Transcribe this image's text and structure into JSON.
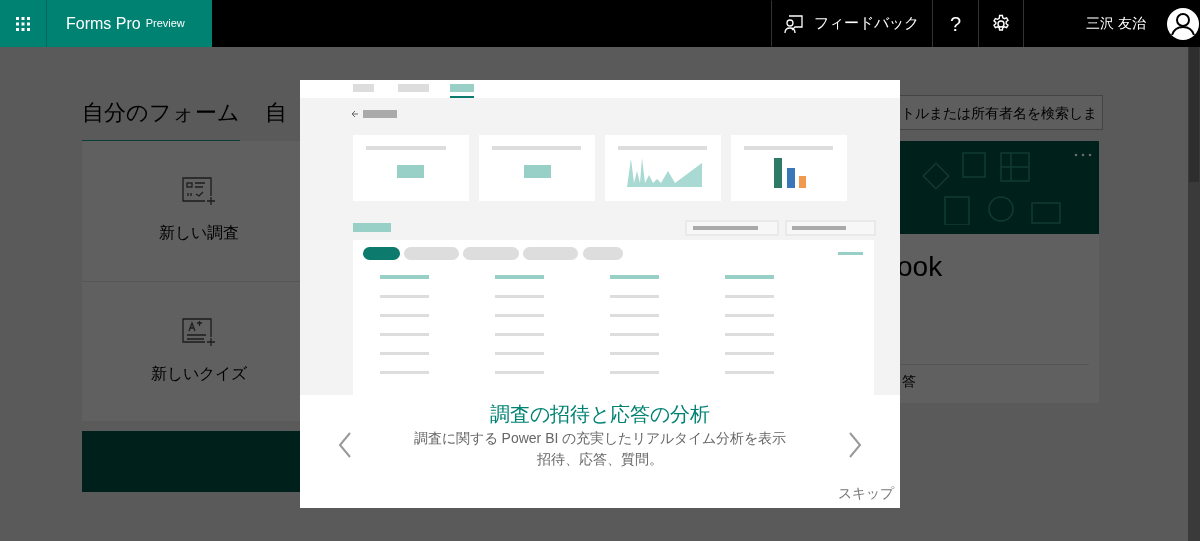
{
  "header": {
    "app_title": "Forms Pro",
    "badge": "Preview",
    "feedback_label": "フィードバック",
    "help_label": "?",
    "user_name": "三沢 友治"
  },
  "tabs": [
    {
      "label": "自分のフォーム",
      "selected": true
    },
    {
      "label": "自",
      "selected": false
    }
  ],
  "search": {
    "placeholder": "トルまたは所有者名を検索しま"
  },
  "new_items": [
    {
      "label": "新しい調査",
      "kind": "survey"
    },
    {
      "label": "新しいクイズ",
      "kind": "quiz"
    }
  ],
  "form_card": {
    "title": "ook",
    "footer": "答"
  },
  "modal": {
    "title": "調査の招待と応答の分析",
    "description_lines": [
      "調査に関する Power BI の充実したリアルタイム分析を表示",
      "招待、応答、質問。"
    ],
    "skip_label": "スキップ"
  }
}
